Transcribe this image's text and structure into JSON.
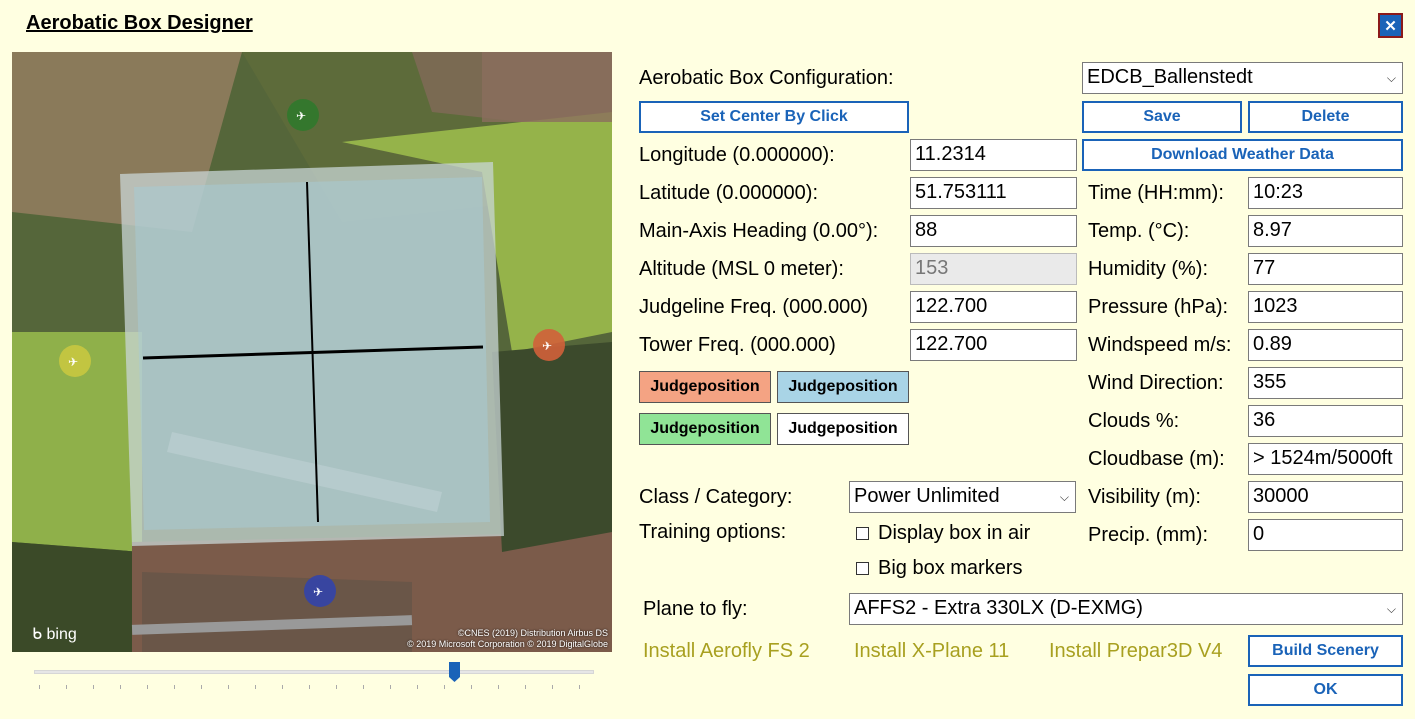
{
  "window": {
    "title": "Aerobatic Box Designer",
    "close_label": "✕"
  },
  "map": {
    "bing_label": "bing",
    "copyright_line1": "©CNES (2019) Distribution Airbus DS",
    "copyright_line2": "© 2019 Microsoft Corporation © 2019 DigitalGlobe"
  },
  "slider": {
    "value_percent": 75
  },
  "config": {
    "label": "Aerobatic Box Configuration:",
    "selected": "EDCB_Ballenstedt",
    "set_center_label": "Set Center By Click",
    "save_label": "Save",
    "delete_label": "Delete",
    "download_weather_label": "Download Weather Data"
  },
  "fields": {
    "longitude": {
      "label": "Longitude (0.000000):",
      "value": "11.2314"
    },
    "latitude": {
      "label": "Latitude (0.000000):",
      "value": "51.753111"
    },
    "heading": {
      "label": "Main-Axis Heading (0.00°):",
      "value": "88"
    },
    "altitude": {
      "label": "Altitude (MSL 0 meter):",
      "value": "153"
    },
    "judgeline": {
      "label": "Judgeline Freq. (000.000)",
      "value": "122.700"
    },
    "tower": {
      "label": "Tower Freq. (000.000)",
      "value": "122.700"
    }
  },
  "judges": [
    {
      "label": "Judgeposition",
      "color": "#f4a383"
    },
    {
      "label": "Judgeposition",
      "color": "#a9d4e6"
    },
    {
      "label": "Judgeposition",
      "color": "#90e496"
    },
    {
      "label": "Judgeposition",
      "color": "#ffffff"
    }
  ],
  "weather": {
    "time": {
      "label": "Time (HH:mm):",
      "value": "10:23"
    },
    "temp": {
      "label": "Temp. (°C):",
      "value": "8.97"
    },
    "humidity": {
      "label": "Humidity (%):",
      "value": "77"
    },
    "pressure": {
      "label": "Pressure (hPa):",
      "value": "1023"
    },
    "windspeed": {
      "label": "Windspeed m/s:",
      "value": "0.89"
    },
    "winddir": {
      "label": "Wind Direction:",
      "value": "355"
    },
    "clouds": {
      "label": "Clouds %:",
      "value": "36"
    },
    "cloudbase": {
      "label": "Cloudbase (m):",
      "value": "> 1524m/5000ft"
    },
    "visibility": {
      "label": "Visibility (m):",
      "value": "30000"
    },
    "precip": {
      "label": "Precip. (mm):",
      "value": "0"
    }
  },
  "class": {
    "label": "Class / Category:",
    "selected": "Power Unlimited"
  },
  "training": {
    "label": "Training options:",
    "display_box": "Display box in air",
    "big_markers": "Big box markers"
  },
  "plane": {
    "label": "Plane to fly:",
    "selected": "AFFS2 - Extra 330LX (D-EXMG)"
  },
  "install": {
    "aerofly": "Install Aerofly FS 2",
    "xplane": "Install X-Plane 11",
    "prepar3d": "Install Prepar3D V4"
  },
  "actions": {
    "build_label": "Build Scenery",
    "ok_label": "OK"
  },
  "colors": {
    "accent": "#1a63b8",
    "background": "#ffffe1",
    "install_link": "#a8a020"
  }
}
